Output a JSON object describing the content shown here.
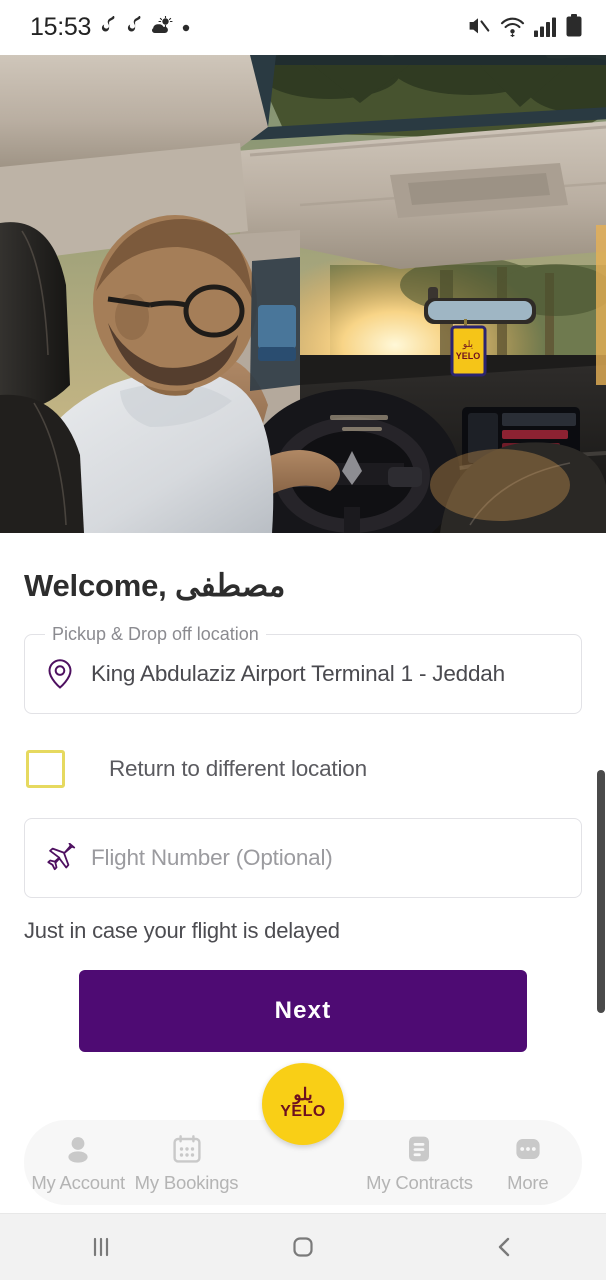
{
  "status_bar": {
    "time": "15:53",
    "left_icons": [
      "music-note-icon",
      "music-note-icon",
      "weather-partly-cloudy-icon",
      "dot-icon"
    ],
    "right_icons": [
      "mute-icon",
      "wifi-icon",
      "cellular-signal-icon",
      "battery-icon"
    ]
  },
  "hero": {
    "alt": "Driver in white shirt at the steering wheel of a car at sunset with palm trees and a yellow YELO air freshener on the rear view mirror",
    "hangtag_text": "YELO"
  },
  "main": {
    "welcome_text": "Welcome, ",
    "user_name": "مصطفى",
    "location_field": {
      "label": "Pickup & Drop off location",
      "value": "King Abdulaziz Airport Terminal 1 - Jeddah",
      "icon": "map-pin-icon"
    },
    "return_checkbox": {
      "label": "Return to different location",
      "checked": false
    },
    "flight_field": {
      "placeholder": "Flight Number (Optional)",
      "value": "",
      "icon": "airplane-icon"
    },
    "flight_helper": "Just in case your flight is delayed",
    "next_button": "Next"
  },
  "bottom_nav": {
    "items": [
      {
        "label": "My Account",
        "icon": "person-icon"
      },
      {
        "label": "My Bookings",
        "icon": "calendar-icon"
      },
      {
        "label": "My Contracts",
        "icon": "document-icon"
      },
      {
        "label": "More",
        "icon": "ellipsis-icon"
      }
    ],
    "fab": {
      "arabic": "يلو",
      "latin": "YELO"
    }
  },
  "android_nav": {
    "recents": "recents-icon",
    "home": "home-icon",
    "back": "back-icon"
  },
  "colors": {
    "brand_purple": "#4E0B73",
    "brand_yellow": "#F9CF16",
    "checkbox_yellow": "#E6D95F",
    "logo_maroon": "#6D1020"
  }
}
